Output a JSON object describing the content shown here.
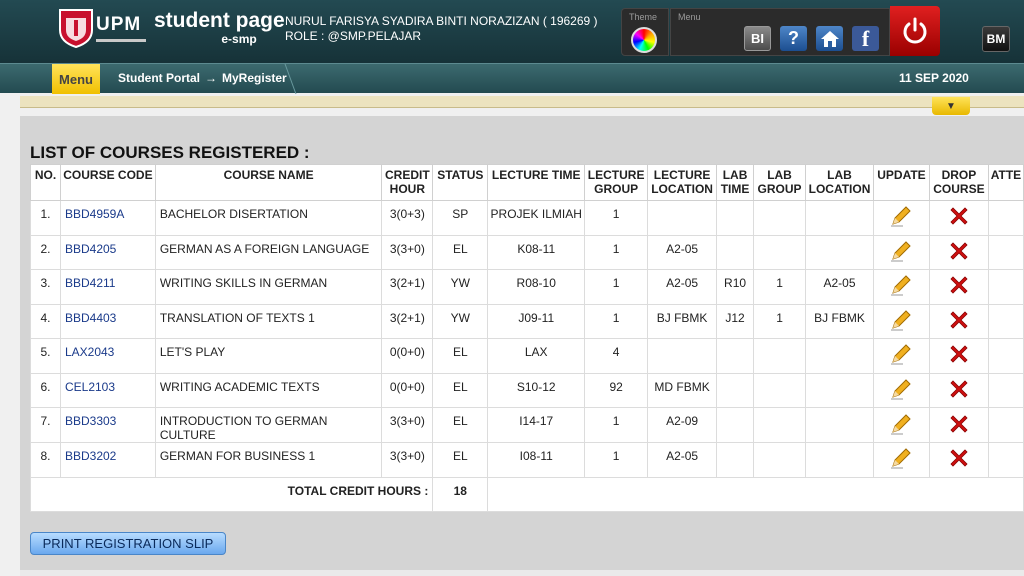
{
  "header": {
    "logo_upm": "UPM",
    "logo_title": "student page",
    "logo_sub": "e-smp",
    "user_line": "NURUL FARISYA SYADIRA BINTI NORAZIZAN ( 196269 )",
    "role_line": "ROLE : @SMP.PELAJAR",
    "theme_label": "Theme",
    "menu_label": "Menu",
    "btn_bi": "BI",
    "btn_help": "?",
    "btn_fb": "f",
    "btn_bm": "BM",
    "power_color": "#d01010"
  },
  "nav": {
    "menu_label": "Menu",
    "crumb_1": "Student Portal",
    "crumb_sep": "→",
    "crumb_2": "MyRegister",
    "date": "11 SEP 2020"
  },
  "list": {
    "title": "LIST OF COURSES REGISTERED :",
    "headers": [
      "NO.",
      "COURSE CODE",
      "COURSE NAME",
      "CREDIT HOUR",
      "STATUS",
      "LECTURE TIME",
      "LECTURE GROUP",
      "LECTURE LOCATION",
      "LAB TIME",
      "LAB GROUP",
      "LAB LOCATION",
      "UPDATE",
      "DROP COURSE",
      "ATTE"
    ],
    "rows": [
      [
        "1.",
        "BBD4959A",
        "BACHELOR DISERTATION",
        "3(0+3)",
        "SP",
        "PROJEK ILMIAH",
        "1",
        "",
        "",
        "",
        ""
      ],
      [
        "2.",
        "BBD4205",
        "GERMAN AS A FOREIGN LANGUAGE",
        "3(3+0)",
        "EL",
        "K08-11",
        "1",
        "A2-05",
        "",
        "",
        ""
      ],
      [
        "3.",
        "BBD4211",
        "WRITING SKILLS IN GERMAN",
        "3(2+1)",
        "YW",
        "R08-10",
        "1",
        "A2-05",
        "R10",
        "1",
        "A2-05"
      ],
      [
        "4.",
        "BBD4403",
        "TRANSLATION OF TEXTS 1",
        "3(2+1)",
        "YW",
        "J09-11",
        "1",
        "BJ FBMK",
        "J12",
        "1",
        "BJ FBMK"
      ],
      [
        "5.",
        "LAX2043",
        "LET'S PLAY",
        "0(0+0)",
        "EL",
        "LAX",
        "4",
        "",
        "",
        "",
        ""
      ],
      [
        "6.",
        "CEL2103",
        "WRITING ACADEMIC TEXTS",
        "0(0+0)",
        "EL",
        "S10-12",
        "92",
        "MD FBMK",
        "",
        "",
        ""
      ],
      [
        "7.",
        "BBD3303",
        "INTRODUCTION TO GERMAN CULTURE",
        "3(3+0)",
        "EL",
        "I14-17",
        "1",
        "A2-09",
        "",
        "",
        ""
      ],
      [
        "8.",
        "BBD3202",
        "GERMAN FOR BUSINESS 1",
        "3(3+0)",
        "EL",
        "I08-11",
        "1",
        "A2-05",
        "",
        "",
        ""
      ]
    ],
    "total_label": "TOTAL CREDIT HOURS :",
    "total_value": "18",
    "update_icon": "pencil-icon",
    "drop_icon": "red-x-icon"
  },
  "print_label": "PRINT REGISTRATION SLIP"
}
